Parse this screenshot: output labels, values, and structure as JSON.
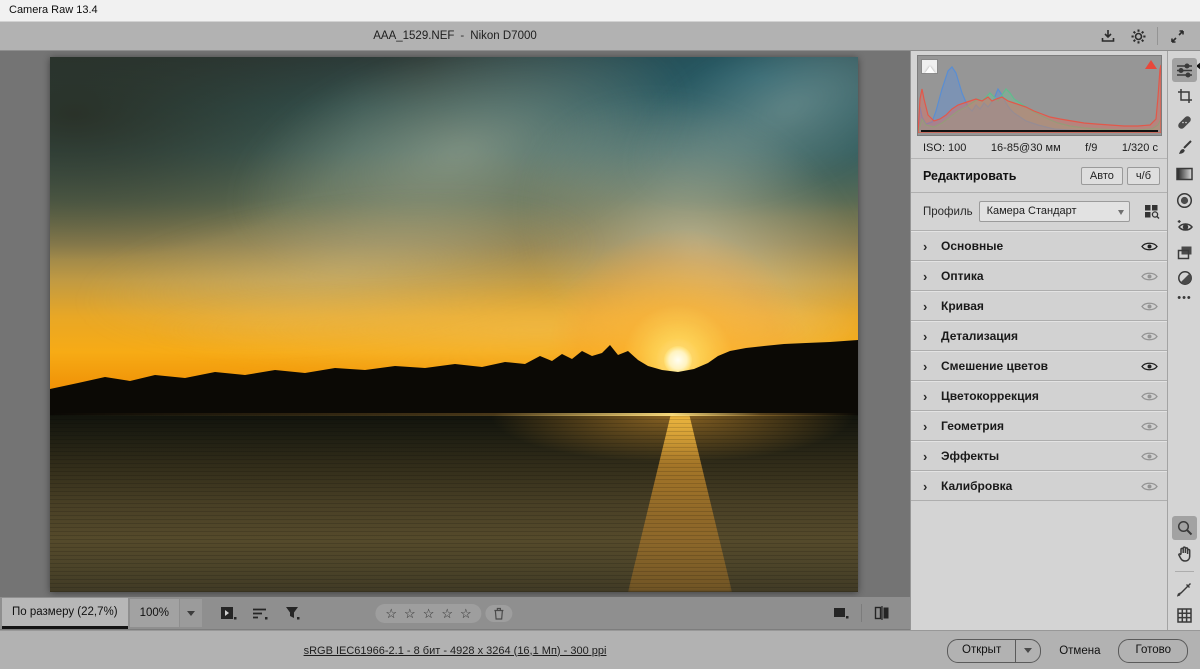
{
  "app": {
    "title": "Camera Raw 13.4"
  },
  "topbar": {
    "filename": "AAA_1529.NEF",
    "separator": "-",
    "camera": "Nikon D7000",
    "icons": [
      "save-icon",
      "gear-icon",
      "fullscreen-icon"
    ]
  },
  "histogram": {
    "channel_colors": {
      "red": "#e2584a",
      "green": "#5fbd8d",
      "blue": "#5a8ed2"
    },
    "clipping": {
      "shadows": "shadow-clipping-indicator",
      "highlights": "highlight-clipping-indicator"
    },
    "exif": {
      "iso": "ISO: 100",
      "lens": "16-85@30 мм",
      "aperture": "f/9",
      "shutter": "1/320 с"
    }
  },
  "edit": {
    "title": "Редактировать",
    "auto_label": "Авто",
    "bw_label": "ч/б",
    "profile_label": "Профиль",
    "profile_value": "Камера Стандарт"
  },
  "sections": [
    {
      "label": "Основные",
      "eye_on": true
    },
    {
      "label": "Оптика",
      "eye_on": false
    },
    {
      "label": "Кривая",
      "eye_on": false
    },
    {
      "label": "Детализация",
      "eye_on": false
    },
    {
      "label": "Смешение цветов",
      "eye_on": true
    },
    {
      "label": "Цветокоррекция",
      "eye_on": false
    },
    {
      "label": "Геометрия",
      "eye_on": false
    },
    {
      "label": "Эффекты",
      "eye_on": false
    },
    {
      "label": "Калибровка",
      "eye_on": false
    }
  ],
  "tools_right": [
    "edit-tool",
    "crop-tool",
    "healing-tool",
    "brush-tool",
    "graduated-filter-tool",
    "radial-filter-tool",
    "red-eye-tool",
    "presets-tool",
    "more-settings-tool",
    "more-dots",
    "zoom-tool",
    "hand-tool",
    "white-balance-sampler-tool",
    "grid-view-tool"
  ],
  "statusbar": {
    "fit_label": "По размеру (22,7%)",
    "zoom_label": "100%",
    "stars_count": 5
  },
  "icons": {
    "star_glyph": "☆",
    "section_chevron": "›",
    "more_glyph": "•••"
  },
  "footer": {
    "info_link": "sRGB IEC61966-2.1 - 8 бит - 4928 x 3264 (16,1 Мп) - 300 ppi",
    "open_label": "Открыт",
    "cancel_label": "Отмена",
    "done_label": "Готово"
  }
}
